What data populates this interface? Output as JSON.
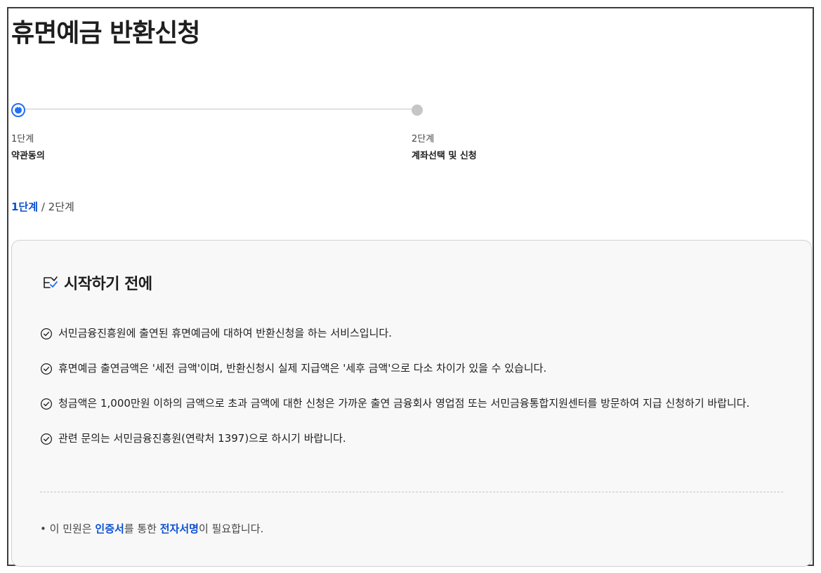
{
  "page": {
    "title": "휴면예금 반환신청"
  },
  "steps": [
    {
      "num": "1단계",
      "label": "약관동의"
    },
    {
      "num": "2단계",
      "label": "계좌선택 및 신청"
    }
  ],
  "breadcrumb": {
    "current": "1단계",
    "sep": "/",
    "next": "2단계"
  },
  "card": {
    "title": "시작하기 전에",
    "items": [
      "서민금융진흥원에 출연된 휴면예금에 대하여 반환신청을 하는 서비스입니다.",
      "휴면예금 출연금액은 '세전 금액'이며, 반환신청시 실제 지급액은 '세후 금액'으로 다소 차이가 있을 수 있습니다.",
      "청금액은 1,000만원 이하의 금액으로 초과 금액에 대한 신청은 가까운 출연 금융회사 영업점 또는 서민금융통합지원센터를 방문하여 지급 신청하기 바랍니다.",
      "관련 문의는 서민금융진흥원(연락처 1397)으로 하시기 바랍니다."
    ],
    "note": {
      "bullet": "•",
      "prefix": "이 민원은",
      "hl1": "인증서",
      "mid": "를 통한",
      "hl2": "전자서명",
      "suffix": "이 필요합니다."
    }
  },
  "colors": {
    "accent": "#256ef4",
    "link": "#0b50d0",
    "inactive": "#c6c6c6"
  }
}
